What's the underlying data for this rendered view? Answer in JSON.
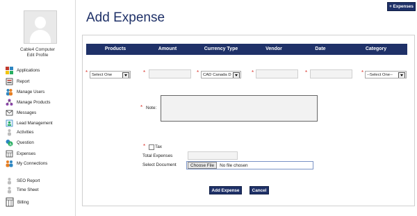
{
  "header": {
    "expenses_button": "+ Expenses",
    "page_title": "Add Expense"
  },
  "profile": {
    "name": "Cable4 Computer",
    "edit_label": "Edit Profile"
  },
  "sidebar": {
    "items": [
      {
        "label": "Applications",
        "icon": "applications-icon"
      },
      {
        "label": "Report",
        "icon": "report-icon"
      },
      {
        "label": "Manage Users",
        "icon": "users-icon"
      },
      {
        "label": "Manage Products",
        "icon": "products-icon"
      },
      {
        "label": "Messages",
        "icon": "messages-icon"
      },
      {
        "label": "Lead Management",
        "icon": "lead-icon"
      },
      {
        "label": "Activities",
        "icon": "activities-icon"
      },
      {
        "label": "Question",
        "icon": "question-icon"
      },
      {
        "label": "Expenses",
        "icon": "expenses-icon"
      },
      {
        "label": "My Connections",
        "icon": "connections-icon"
      },
      {
        "label": "SEO Report",
        "icon": "seo-report-icon"
      },
      {
        "label": "Time Sheet",
        "icon": "time-sheet-icon"
      },
      {
        "label": "Billing",
        "icon": "billing-icon"
      }
    ]
  },
  "table": {
    "headers": [
      "Products",
      "Amount",
      "Currency Type",
      "Vendor",
      "Date",
      "Category"
    ]
  },
  "form": {
    "required_marker": "*",
    "products_select": "Select One",
    "currency_select": "CAD Canada D",
    "category_select": "--Select One--",
    "note_label": "Note:",
    "tax_label": "Tax",
    "total_expenses_label": "Total Expenses",
    "select_document_label": "Select Document",
    "choose_file_button": "Choose File",
    "no_file_text": "No file chosen"
  },
  "actions": {
    "add_label": "Add Expense",
    "cancel_label": "Cancel"
  },
  "colors": {
    "accent": "#1f3168",
    "required": "#d9322a"
  }
}
